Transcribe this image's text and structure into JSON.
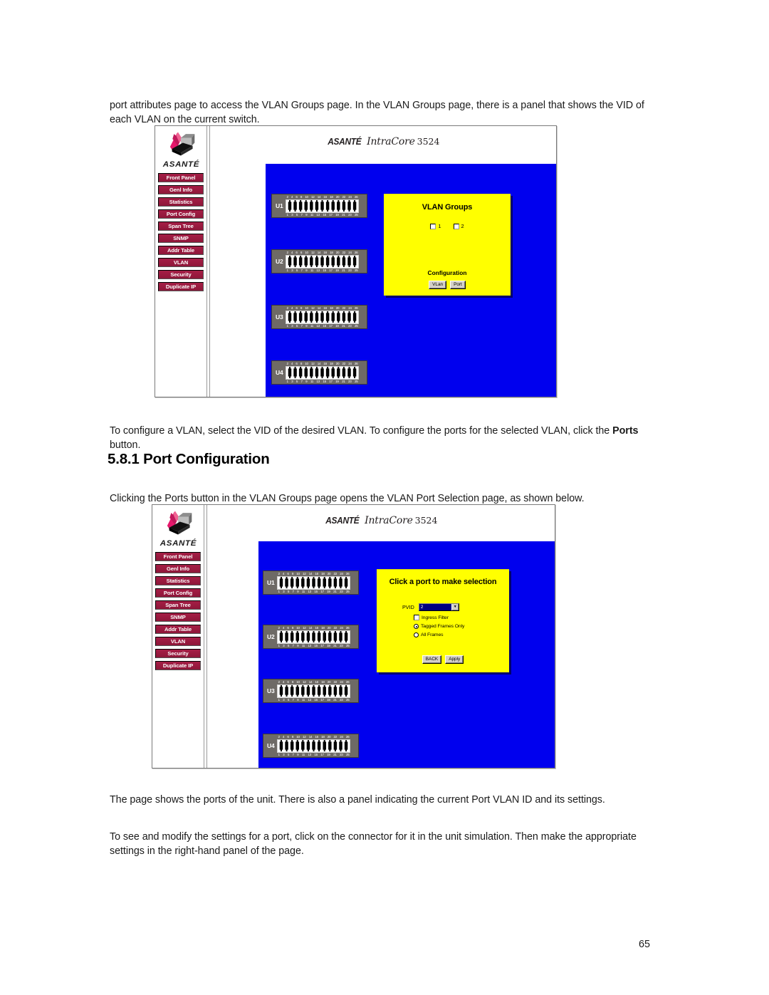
{
  "document": {
    "page_number": "65",
    "paragraphs": {
      "intro": "port attributes page to access the VLAN Groups page. In the VLAN Groups page, there is a panel that shows the VID of each VLAN on the current switch.",
      "configure_lead": "To configure a VLAN, select the VID of the desired VLAN. To configure the ports for the selected VLAN, click the ",
      "configure_bold": "Ports",
      "configure_tail": " button.",
      "heading": "5.8.1 Port Configuration",
      "clicking": "Clicking the Ports button in the VLAN Groups page opens the VLAN Port Selection page, as shown below.",
      "page_shows": "The page shows the ports of the unit. There is also a panel indicating the current Port VLAN ID and its settings.",
      "see_modify": "To see and modify the settings for a port, click on the connector for it in the unit simulation. Then make the appropriate settings in the right-hand panel of the page."
    }
  },
  "colors": {
    "nav_button": "#9e1b42",
    "canvas_blue": "#0000ee",
    "panel_yellow": "#ffff00",
    "unit_gray": "#6e6a66",
    "select_highlight": "#000080"
  },
  "screenshot_common": {
    "logo_alt": "ASANTÉ",
    "logo_word": "ASANTÉ",
    "brand_asante": "ASANTÉ",
    "brand_product": "IntraCore",
    "brand_model": "3524",
    "nav_items": [
      {
        "label": "Front Panel",
        "name": "front-panel"
      },
      {
        "label": "Genl Info",
        "name": "genl-info"
      },
      {
        "label": "Statistics",
        "name": "statistics"
      },
      {
        "label": "Port Config",
        "name": "port-config"
      },
      {
        "label": "Span Tree",
        "name": "span-tree"
      },
      {
        "label": "SNMP",
        "name": "snmp"
      },
      {
        "label": "Addr Table",
        "name": "addr-table"
      },
      {
        "label": "VLAN",
        "name": "vlan"
      },
      {
        "label": "Security",
        "name": "security"
      },
      {
        "label": "Duplicate IP",
        "name": "duplicate-ip"
      }
    ],
    "units": [
      {
        "label": "U1"
      },
      {
        "label": "U2"
      },
      {
        "label": "U3"
      },
      {
        "label": "U4"
      }
    ],
    "port_numbers_top": [
      "2",
      "4",
      "6",
      "8",
      "10",
      "12",
      "14",
      "16",
      "18",
      "20",
      "22",
      "24",
      "26"
    ],
    "port_numbers_bottom": [
      "1",
      "3",
      "5",
      "7",
      "9",
      "11",
      "13",
      "15",
      "17",
      "19",
      "21",
      "23",
      "25"
    ]
  },
  "screenshot_vlan_groups": {
    "panel_title": "VLAN Groups",
    "vlan_checkboxes": [
      {
        "label": "1",
        "checked": false
      },
      {
        "label": "2",
        "checked": false
      }
    ],
    "configuration_label": "Configuration",
    "buttons": [
      {
        "label": "VLan"
      },
      {
        "label": "Port"
      }
    ]
  },
  "screenshot_port_selection": {
    "panel_title": "Click a port to make selection",
    "pvid_label": "PVID",
    "pvid_value": "2",
    "ingress_filter": {
      "label": "Ingress Filter",
      "checked": false
    },
    "frame_options": [
      {
        "label": "Tagged Frames Only",
        "selected": true
      },
      {
        "label": "All Frames",
        "selected": false
      }
    ],
    "buttons": [
      {
        "label": "BACK"
      },
      {
        "label": "Apply"
      }
    ]
  }
}
